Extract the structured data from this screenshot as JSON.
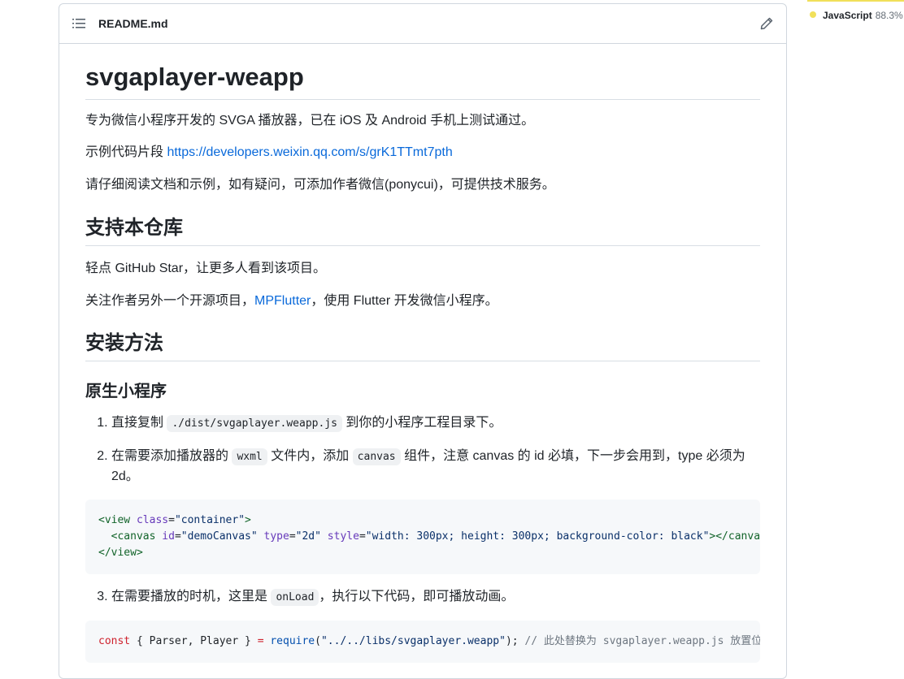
{
  "readme": {
    "filename": "README.md",
    "title": "svgaplayer-weapp",
    "intro": "专为微信小程序开发的 SVGA 播放器，已在 iOS 及 Android 手机上测试通过。",
    "sample_prefix": "示例代码片段 ",
    "sample_link": "https://developers.weixin.qq.com/s/grK1TTmt7pth",
    "read_note": "请仔细阅读文档和示例，如有疑问，可添加作者微信(ponycui)，可提供技术服务。",
    "support_heading": "支持本仓库",
    "support_line1": "轻点 GitHub Star，让更多人看到该项目。",
    "support_line2_prefix": "关注作者另外一个开源项目，",
    "support_line2_link": "MPFlutter",
    "support_line2_suffix": "，使用 Flutter 开发微信小程序。",
    "install_heading": "安装方法",
    "native_heading": "原生小程序",
    "step1_prefix": "直接复制 ",
    "step1_code": "./dist/svgaplayer.weapp.js",
    "step1_suffix": " 到你的小程序工程目录下。",
    "step2_prefix": "在需要添加播放器的 ",
    "step2_code1": "wxml",
    "step2_mid": " 文件内，添加 ",
    "step2_code2": "canvas",
    "step2_suffix": " 组件，注意 canvas 的 id 必填，下一步会用到，type 必须为 2d。",
    "code_block1": {
      "l1_open": "<view ",
      "l1_attr": "class",
      "l1_eq": "=",
      "l1_val": "\"container\"",
      "l1_close": ">",
      "l2_indent": "  ",
      "l2_open": "<canvas ",
      "l2_a1": "id",
      "l2_v1": "\"demoCanvas\"",
      "l2_a2": "type",
      "l2_v2": "\"2d\"",
      "l2_a3": "style",
      "l2_v3": "\"width: 300px; height: 300px; background-color: black\"",
      "l2_close": "></canvas>",
      "l3": "</view>"
    },
    "step3_prefix": "在需要播放的时机，这里是 ",
    "step3_code": "onLoad",
    "step3_suffix": "，执行以下代码，即可播放动画。",
    "code_block2": {
      "kw": "const",
      "destruct": " { Parser, Player } ",
      "eq": "=",
      "fn": " require",
      "arg_open": "(",
      "arg": "\"../../libs/svgaplayer.weapp\"",
      "arg_close": ");",
      "comment": " // 此处替换为 svgaplayer.weapp.js 放置位置"
    }
  },
  "languages": [
    {
      "name": "JavaScript",
      "percent": "88.3%",
      "color": "#f1e05a"
    }
  ]
}
